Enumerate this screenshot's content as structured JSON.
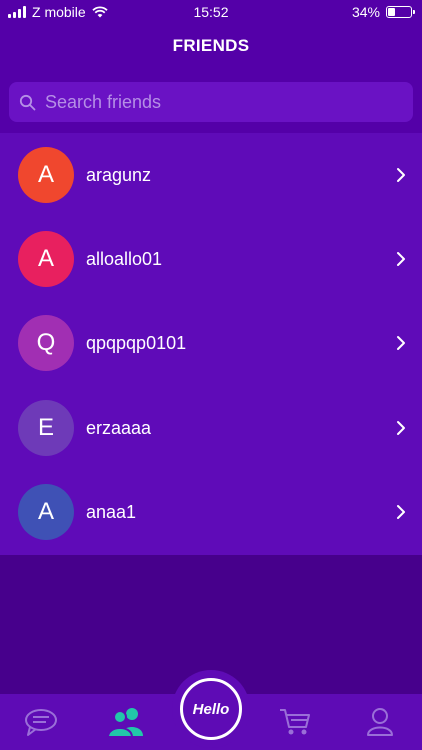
{
  "status_bar": {
    "carrier": "Z mobile",
    "time": "15:52",
    "battery_percent": "34%",
    "battery_level": 0.34
  },
  "header": {
    "title": "FRIENDS"
  },
  "search": {
    "placeholder": "Search friends"
  },
  "friends": [
    {
      "initial": "A",
      "name": "aragunz",
      "color": "#f0472e"
    },
    {
      "initial": "A",
      "name": "alloallo01",
      "color": "#e8205f"
    },
    {
      "initial": "Q",
      "name": "qpqpqp0101",
      "color": "#a12fb3"
    },
    {
      "initial": "E",
      "name": "erzaaaa",
      "color": "#6e3ab8"
    },
    {
      "initial": "A",
      "name": "anaa1",
      "color": "#3f51b5"
    }
  ],
  "tabbar": {
    "items": [
      {
        "icon": "chat-bubbles-icon",
        "active": false
      },
      {
        "icon": "friends-icon",
        "active": true
      },
      {
        "icon": "hello-button",
        "label": "Hello"
      },
      {
        "icon": "cart-icon",
        "active": false
      },
      {
        "icon": "profile-icon",
        "active": false
      }
    ],
    "active_color": "#22c7a9",
    "inactive_color": "#9a6fd8"
  }
}
